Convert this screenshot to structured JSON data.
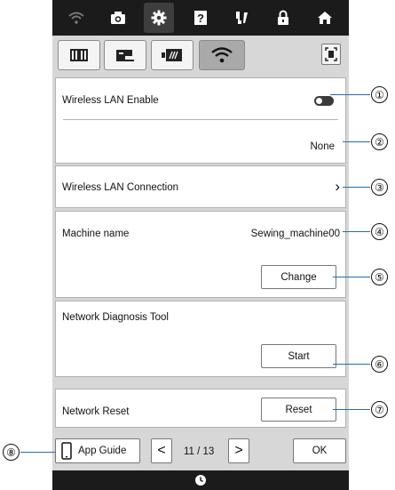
{
  "top_icons": [
    "wifi-icon",
    "camera-icon",
    "gear-icon",
    "help-icon",
    "needle-icon",
    "lock-icon",
    "home-icon"
  ],
  "tabs": [
    "book-icon",
    "machine-icon",
    "embroidery-frame-icon",
    "wifi-icon"
  ],
  "wlan_enable": {
    "label": "Wireless LAN Enable",
    "toggle_on": false
  },
  "network_status": {
    "value": "None"
  },
  "wlan_connection": {
    "label": "Wireless LAN Connection",
    "arrow": "›"
  },
  "machine_name": {
    "label": "Machine name",
    "value": "Sewing_machine00",
    "change_label": "Change"
  },
  "diagnosis": {
    "label": "Network Diagnosis Tool",
    "start_label": "Start"
  },
  "reset": {
    "label": "Network Reset",
    "reset_label": "Reset"
  },
  "bottom": {
    "app_guide_label": "App Guide",
    "prev": "<",
    "page": "11 / 13",
    "next": ">",
    "ok_label": "OK"
  },
  "callouts": [
    "①",
    "②",
    "③",
    "④",
    "⑤",
    "⑥",
    "⑦",
    "⑧"
  ],
  "colors": {
    "callout_line": "#1f6fb5",
    "topbar": "#1b1b1b",
    "panel": "#d7d7d7"
  }
}
